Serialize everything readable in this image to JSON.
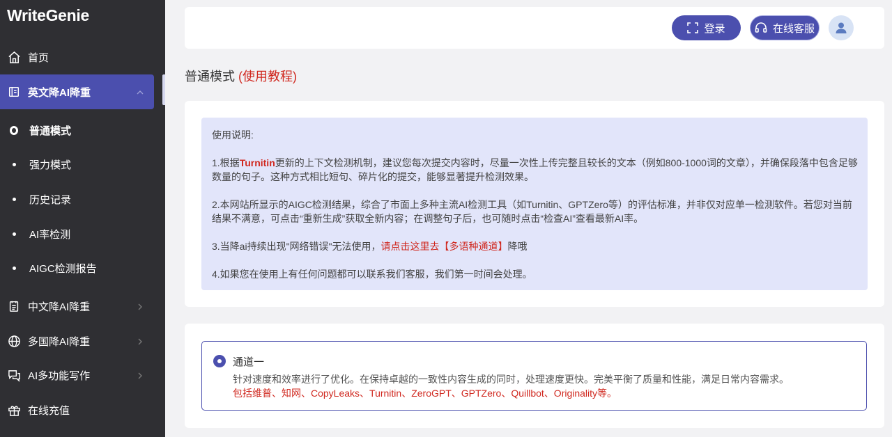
{
  "app": {
    "logo": "WriteGenie"
  },
  "sidebar": {
    "home": "首页",
    "english_reduce": "英文降AI降重",
    "sub_items": [
      "普通模式",
      "强力模式",
      "历史记录",
      "AI率检测",
      "AIGC检测报告"
    ],
    "chinese_reduce": "中文降AI降重",
    "multi_country": "多国降AI降重",
    "ai_writing": "AI多功能写作",
    "recharge": "在线充值"
  },
  "header": {
    "login": "登录",
    "service": "在线客服"
  },
  "page": {
    "title": "普通模式",
    "tutorial": "(使用教程)"
  },
  "instructions": {
    "heading": "使用说明:",
    "p1_pre": "1.根据",
    "p1_brand": "Turnitin",
    "p1_post": "更新的上下文检测机制，建议您每次提交内容时，尽量一次性上传完整且较长的文本（例如800-1000词的文章），并确保段落中包含足够数量的句子。这种方式相比短句、碎片化的提交，能够显著提升检测效果。",
    "p2": "2.本网站所显示的AIGC检测结果，综合了市面上多种主流AI检测工具（如Turnitin、GPTZero等）的评估标准，并非仅对应单一检测软件。若您对当前结果不满意，可点击“重新生成”获取全新内容；在调整句子后，也可随时点击“检查AI”查看最新AI率。",
    "p3_pre": "3.当降ai持续出现\"网络错误\"无法使用，",
    "p3_link": "请点击这里去【多语种通道】",
    "p3_post": "降哦",
    "p4": "4.如果您在使用上有任何问题都可以联系我们客服，我们第一时间会处理。"
  },
  "channel": {
    "title": "通道一",
    "desc": "针对速度和效率进行了优化。在保持卓越的一致性内容生成的同时，处理速度更快。完美平衡了质量和性能，满足日常内容需求。",
    "support": "包括维普、知网、CopyLeaks、Turnitin、ZeroGPT、GPTZero、Quillbot、Originality等。"
  },
  "colors": {
    "sidebar_bg": "#2f2f33",
    "accent": "#4b4fae",
    "red": "#d0281f",
    "info_bg": "#e2e5fa"
  }
}
